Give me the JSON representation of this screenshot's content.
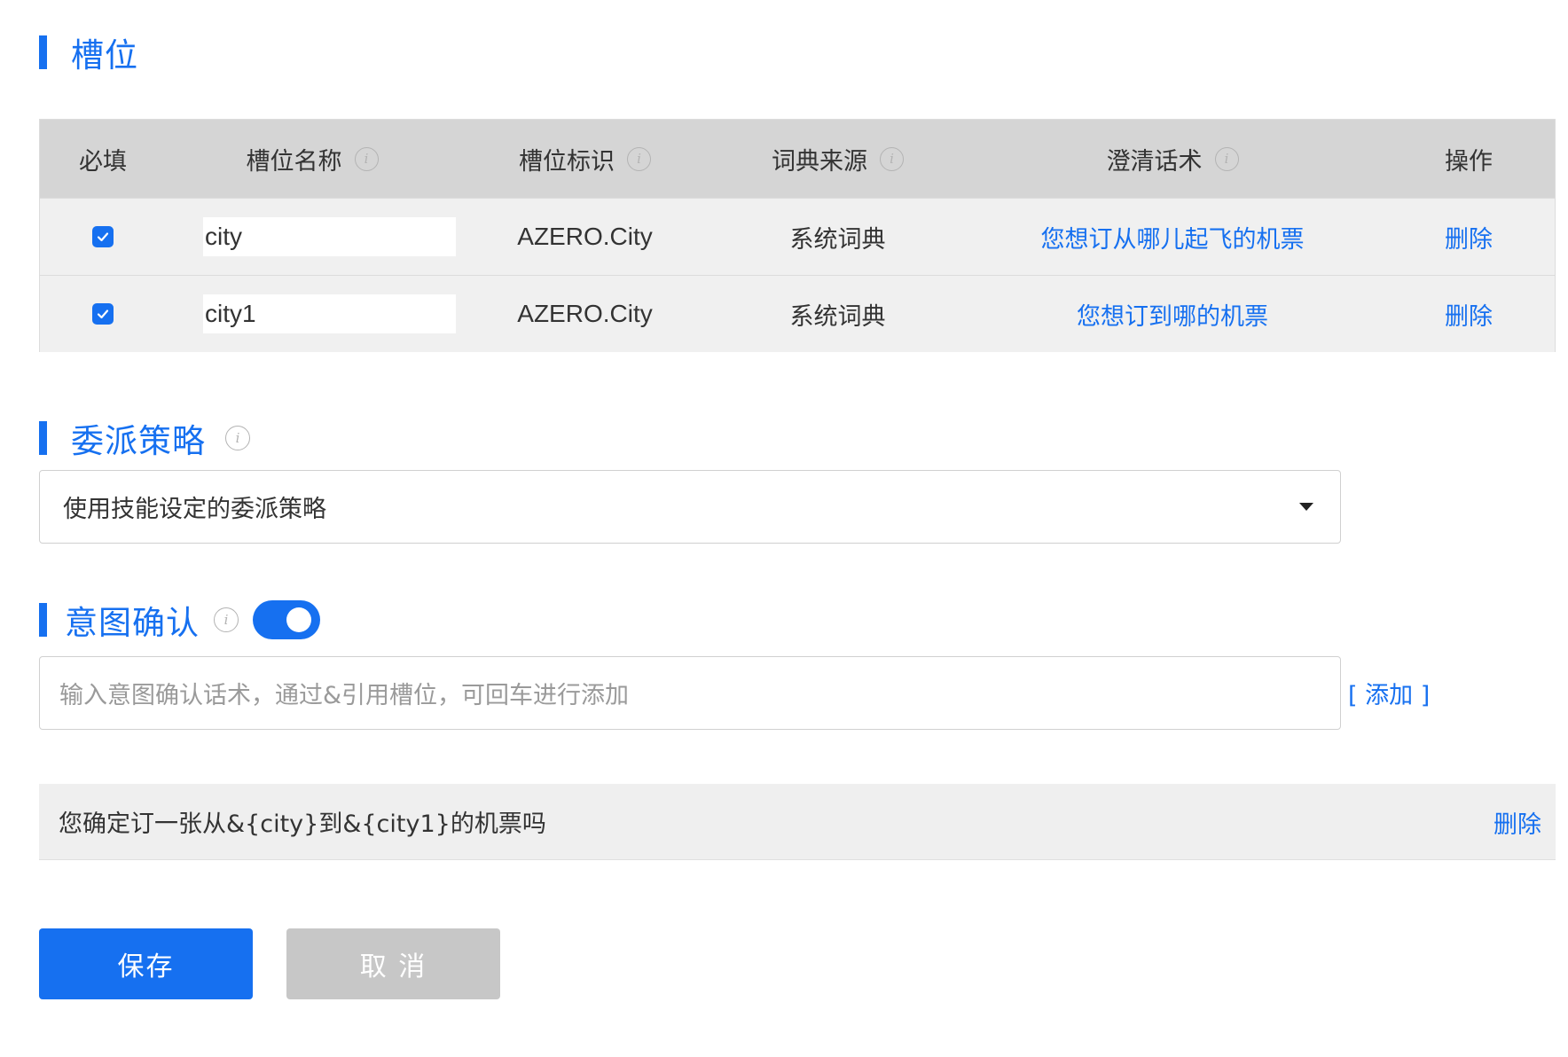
{
  "slots_section": {
    "title": "槽位"
  },
  "slot_table": {
    "headers": {
      "required": "必填",
      "slot_name": "槽位名称",
      "slot_key": "槽位标识",
      "dict_source": "词典来源",
      "clarification": "澄清话术",
      "actions": "操作"
    },
    "rows": [
      {
        "required": true,
        "name": "city",
        "key": "AZERO.City",
        "source": "系统词典",
        "clarification": "您想订从哪儿起飞的机票",
        "delete": "删除"
      },
      {
        "required": true,
        "name": "city1",
        "key": "AZERO.City",
        "source": "系统词典",
        "clarification": "您想订到哪的机票",
        "delete": "删除"
      }
    ]
  },
  "delegation_section": {
    "title": "委派策略",
    "selected": "使用技能设定的委派策略"
  },
  "intent_confirm_section": {
    "title": "意图确认",
    "enabled": true,
    "input_placeholder": "输入意图确认话术，通过&引用槽位，可回车进行添加",
    "add_label": "[ 添加 ]",
    "items": [
      {
        "text": "您确定订一张从&{city}到&{city1}的机票吗",
        "delete": "删除"
      }
    ]
  },
  "actions": {
    "save": "保存",
    "cancel": "取 消"
  },
  "colors": {
    "accent": "#1670f0",
    "header_bg": "#d5d5d5",
    "row_bg": "#f0f0f0",
    "cancel_bg": "#c7c7c7"
  },
  "icons": [
    "info-icon",
    "check-icon",
    "caret-down-icon",
    "toggle-switch"
  ]
}
